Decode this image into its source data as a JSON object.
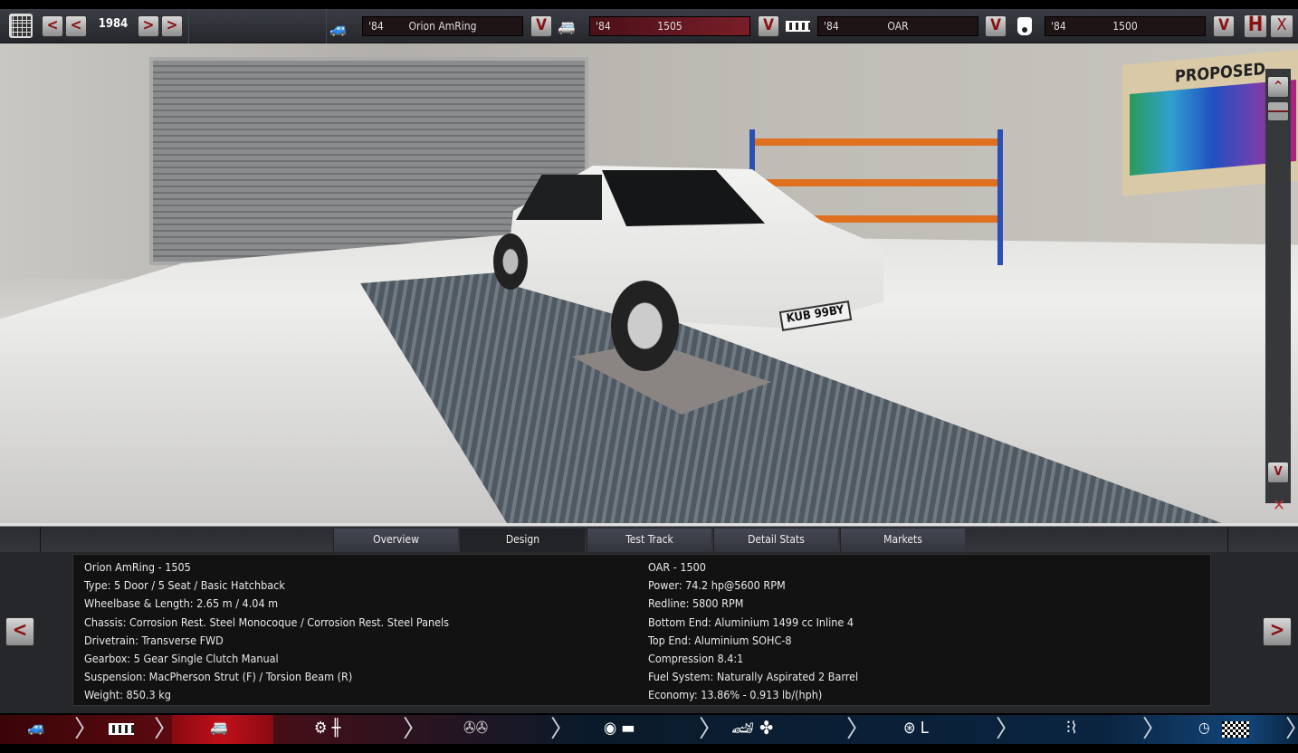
{
  "topbar": {
    "year": "1984",
    "model": {
      "year": "'84",
      "name": "Orion AmRing"
    },
    "trim": {
      "year": "'84",
      "name": "1505"
    },
    "engine_family": {
      "year": "'84",
      "name": "OAR"
    },
    "engine_variant": {
      "year": "'84",
      "name": "1500"
    },
    "dropdown_label": "V",
    "prev_label": "<",
    "next_label": ">",
    "save_label": "H",
    "close_label": "X"
  },
  "scene": {
    "board_text": "PROPOSED",
    "plate": "KUB 99BY",
    "scroll_up": "^",
    "scroll_down": "V"
  },
  "tabs": [
    {
      "label": "Overview"
    },
    {
      "label": "Design"
    },
    {
      "label": "Test Track"
    },
    {
      "label": "Detail Stats"
    },
    {
      "label": "Markets"
    }
  ],
  "info": {
    "left": [
      "Orion AmRing - 1505",
      "Type: 5 Door / 5 Seat / Basic Hatchback",
      "Wheelbase & Length: 2.65 m / 4.04 m",
      "Chassis: Corrosion Rest. Steel Monocoque / Corrosion Rest. Steel Panels",
      "Drivetrain: Transverse FWD",
      "Gearbox: 5 Gear Single Clutch Manual",
      "Suspension: MacPherson Strut (F) / Torsion Beam (R)",
      "Weight: 850.3 kg"
    ],
    "right": [
      "OAR - 1500",
      "Power: 74.2 hp@5600 RPM",
      "Redline: 5800 RPM",
      "Bottom End: Aluminium 1499 cc Inline 4",
      "Top End: Aluminium SOHC-8",
      "Compression 8.4:1",
      "Fuel System: Naturally Aspirated 2 Barrel",
      "Economy: 13.86% - 0.913 lb/(hph)"
    ],
    "prev": "<",
    "next": ">"
  },
  "colors": {
    "accent": "#8a1010",
    "nav_active": "#c0101a",
    "nav_blue": "#0a2440"
  }
}
